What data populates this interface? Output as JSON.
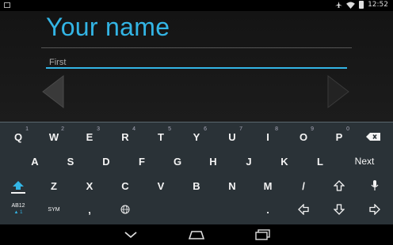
{
  "status_bar": {
    "time": "12:52",
    "icons": [
      "notification-icon",
      "airplane-icon",
      "wifi-icon",
      "battery-icon"
    ]
  },
  "screen": {
    "title": "Your name",
    "name_field": {
      "value": "",
      "placeholder": "First"
    },
    "prev_arrow_icon": "triangle-left",
    "next_arrow_icon": "triangle-right",
    "accent_color": "#33b5e5"
  },
  "keyboard": {
    "row1": [
      {
        "label": "Q",
        "hint": "1"
      },
      {
        "label": "W",
        "hint": "2"
      },
      {
        "label": "E",
        "hint": "3"
      },
      {
        "label": "R",
        "hint": "4"
      },
      {
        "label": "T",
        "hint": "5"
      },
      {
        "label": "Y",
        "hint": "6"
      },
      {
        "label": "U",
        "hint": "7"
      },
      {
        "label": "I",
        "hint": "8"
      },
      {
        "label": "O",
        "hint": "9"
      },
      {
        "label": "P",
        "hint": "0"
      }
    ],
    "row2": [
      "A",
      "S",
      "D",
      "F",
      "G",
      "H",
      "J",
      "K",
      "L"
    ],
    "next_label": "Next",
    "row3": [
      "Z",
      "X",
      "C",
      "V",
      "B",
      "N",
      "M",
      "/"
    ],
    "row4": {
      "mode_key": "AB12",
      "mode_sub": "▲ 1",
      "sym_key": "SYM",
      "comma": ",",
      "period": "."
    }
  }
}
